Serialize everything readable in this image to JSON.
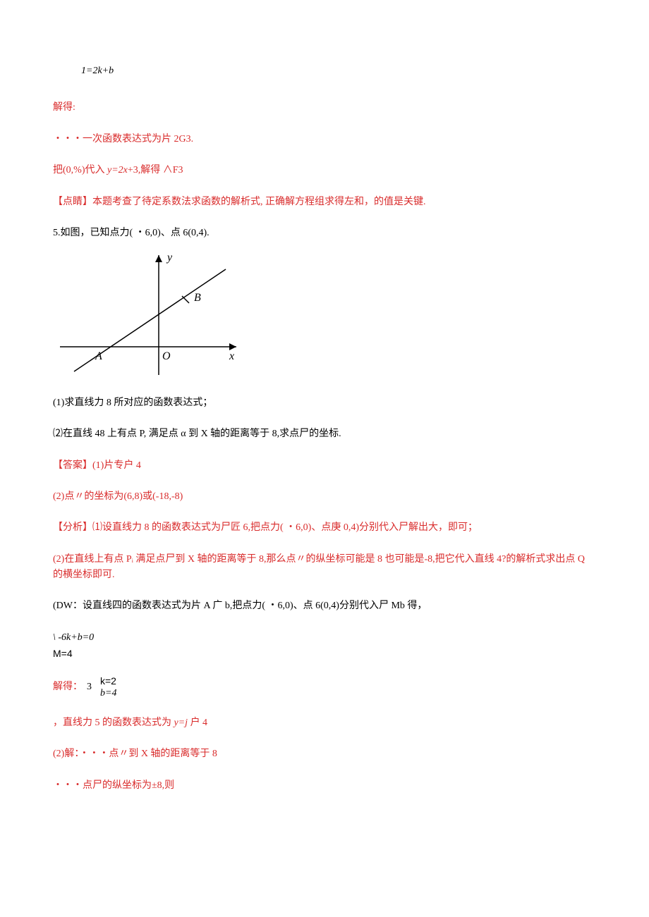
{
  "eq_top": "1=2k+b",
  "p_solve": "解得:",
  "p_linear": "・・・一次函数表达式为片 2G3.",
  "p_sub1": "把(0,%)代入 ",
  "p_sub1_eq": "y=2x",
  "p_sub1_tail": "+3,解得 ∧F3",
  "p_point": "【点睛】本题考查了待定系数法求函数的解析式, 正确解方程组求得左和，的值是关键.",
  "q5_intro": "5.如图，已知点力( ・6,0)、点 6(0,4).",
  "graph": {
    "axis_x": "x",
    "axis_y": "y",
    "origin": "O",
    "point_a": "A",
    "point_b": "B"
  },
  "q5_1": "(1)求直线力 8 所对应的函数表达式；",
  "q5_2": "⑵在直线 48 上有点 P, 满足点 α 到 X 轴的距离等于 8,求点尸的坐标.",
  "ans_head": "【答案】(1)片专户 4",
  "ans_2": "(2)点〃的坐标为(6,8)或(-18,-8)",
  "analysis_1": "【分析】⑴设直线力 8 的函数表达式为尸匠 6,把点力( ・6,0)、点庚 0,4)分别代入尸解出大，即可；",
  "analysis_2": "(2)在直线上有点 Pᵢ 满足点尸到 X 轴的距离等于 8,那么点〃的纵坐标可能是 8 也可能是-8,把它代入直线 4?的解析式求出点 Q 的横坐标即可.",
  "dw": "(DW：设直线四的函数表达式为片 A 广 b,把点力( ・6,0)、点 6(0,4)分别代入尸 Mb 得，",
  "sys_row1": "\\ -6k+b=0",
  "sys_row2": "M=4",
  "solve2_lead": "解得：",
  "solve2_mid": "3",
  "solve2_top": "k=2",
  "solve2_bot": "b=4",
  "line_expr_a": "，直线力 5 的函数表达式为 ",
  "line_expr_eq": "y=j",
  "line_expr_tail": " 户 4",
  "q2_solve": "(2)解：・・・点〃到 X 轴的距离等于 8",
  "end_line": "・・・点尸的纵坐标为±8,则"
}
